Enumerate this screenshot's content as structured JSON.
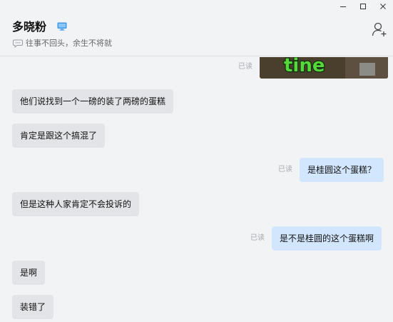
{
  "header": {
    "contact_name": "多晓粉",
    "signature": "往事不回头，余生不将就"
  },
  "chat": {
    "image_message": {
      "read_label": "已读",
      "overlay_text": "tine"
    },
    "messages": [
      {
        "side": "left",
        "text": "他们说找到一个一磅的装了两磅的蛋糕"
      },
      {
        "side": "left",
        "text": "肯定是跟这个搞混了"
      },
      {
        "side": "right",
        "text": "是桂圆这个蛋糕？",
        "read_label": "已读"
      },
      {
        "side": "left",
        "text": "但是这种人家肯定不会投诉的"
      },
      {
        "side": "right",
        "text": "是不是桂圆的这个蛋糕啊",
        "read_label": "已读"
      },
      {
        "side": "left",
        "text": "是啊"
      },
      {
        "side": "left",
        "text": "装错了"
      }
    ]
  },
  "colors": {
    "background": "#f2f3f5",
    "incoming_bubble": "#e3e4e7",
    "outgoing_bubble": "#d2e6fd",
    "read_text": "#a6a8ad",
    "online_device_icon": "#3d9ae8"
  },
  "icons": {
    "window_controls": [
      "minimize-icon",
      "maximize-icon",
      "close-icon"
    ],
    "status": "computer-online-icon",
    "signature": "speech-bubble-icon",
    "add_friend": "add-friend-icon"
  }
}
